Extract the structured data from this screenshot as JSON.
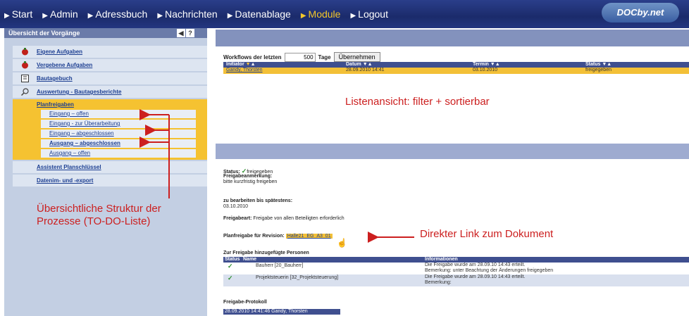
{
  "nav": {
    "items": [
      "Start",
      "Admin",
      "Adressbuch",
      "Nachrichten",
      "Datenablage",
      "Module",
      "Logout"
    ],
    "active": "Module",
    "logo": "DOCby.net"
  },
  "sidebar": {
    "title": "Übersicht der Vorgänge",
    "buttons": [
      "◀",
      "?"
    ],
    "items": [
      {
        "label": "Eigene Aufgaben",
        "icon": "red-task-icon"
      },
      {
        "label": "Vergebene Aufgaben",
        "icon": "red-task-icon"
      },
      {
        "label": "Bautagebuch",
        "icon": "book-icon"
      },
      {
        "label": "Auswertung - Bautagesberichte",
        "icon": "magnifier-icon"
      }
    ],
    "planfreigaben": {
      "label": "Planfreigaben",
      "subitems": [
        "Eingang – offen",
        "Eingang - zur Überarbeitung",
        "Eingang – abgeschlossen",
        "Ausgang – abgeschlossen",
        "Ausgang – offen"
      ]
    },
    "bottom_items": [
      "Assistent Planschlüssel",
      "Datenim- und -export"
    ]
  },
  "filter": {
    "label": "Workflows der letzten",
    "value": "500",
    "unit": "Tage",
    "button": "Übernehmen"
  },
  "table": {
    "headers": [
      "Initiator",
      "Datum",
      "Termin",
      "Status"
    ],
    "rows": [
      [
        "Gandy, Thorsten",
        "28.09.2010 14:41",
        "03.10.2010",
        "freigegeben"
      ]
    ]
  },
  "detail": {
    "status_label": "Status:",
    "status_value": "freigegeben",
    "remark_label": "Freigabeanmerkung:",
    "remark_value": "bitte kurzfristig freigeben",
    "deadline_label": "zu bearbeiten bis spätestens:",
    "deadline_value": "03.10.2010",
    "type_label": "Freigabeart:",
    "type_value": "Freigabe von allen Beteiligten erforderlich",
    "revision_label": "Planfreigabe für Revision:",
    "revision_link": "Halle21_EG_A3_01",
    "persons_title": "Zur Freigabe hinzugefügte Personen",
    "persons_headers": [
      "Status",
      "Name",
      "Informationen"
    ],
    "persons": [
      {
        "name": "Bauherr [20_Bauherr]",
        "info1": "Die Freigabe wurde am 28.09.10 14:43 erteilt.",
        "info2": "Bemerkung: unter Beachtung der Änderungen freigegeben"
      },
      {
        "name": "Projektsteuerin [32_Projektsteuerung]",
        "info1": "Die Freigabe wurde am 28.09.10 14:43 erteilt.",
        "info2": "Bemerkung:"
      }
    ],
    "protocol_label": "Freigabe-Protokoll",
    "protocol_entry": "28.09.2010 14:41:46 Gandy, Thorsten"
  },
  "annotations": {
    "list": "Listenansicht: filter + sortierbar",
    "structure_line1": "Übersichtliche Struktur der",
    "structure_line2": "Prozesse (TO-DO-Liste)",
    "link": "Direkter Link zum Dokument"
  },
  "colors": {
    "nav_bg": "#1b2b6b",
    "accent": "#f3c037",
    "annotation": "#cc1f1f",
    "sidebar_bg": "#c3cfe3"
  }
}
